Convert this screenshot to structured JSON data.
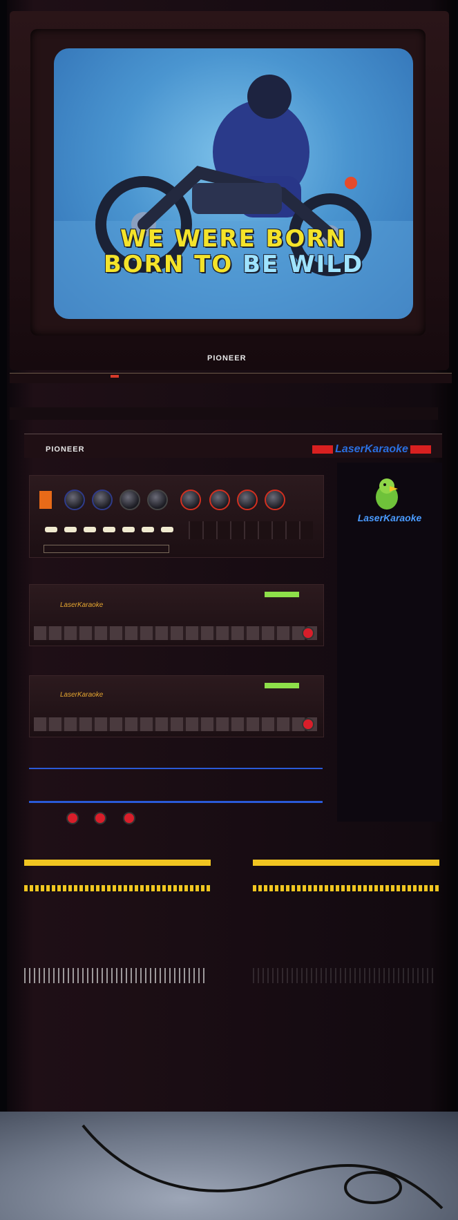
{
  "tv": {
    "lyrics": {
      "line1": "WE WERE BORN",
      "line2_part1": "BORN TO ",
      "line2_part2": "BE WILD"
    },
    "brand": "PIONEER"
  },
  "rack": {
    "brand": "PIONEER",
    "laserkaraoke_badge": "LaserKaraoke",
    "laserkaraoke_logo_text": "LaserKaraoke",
    "player1_label": "LaserKaraoke",
    "player2_label": "LaserKaraoke"
  },
  "colors": {
    "lyric_highlight": "#f4e32a",
    "lyric_sung": "#9fe3ff",
    "screen_blue": "#4a95d0",
    "meter_yellow": "#f1c521",
    "badge_red": "#d82020",
    "badge_blue": "#2a6fe0"
  }
}
